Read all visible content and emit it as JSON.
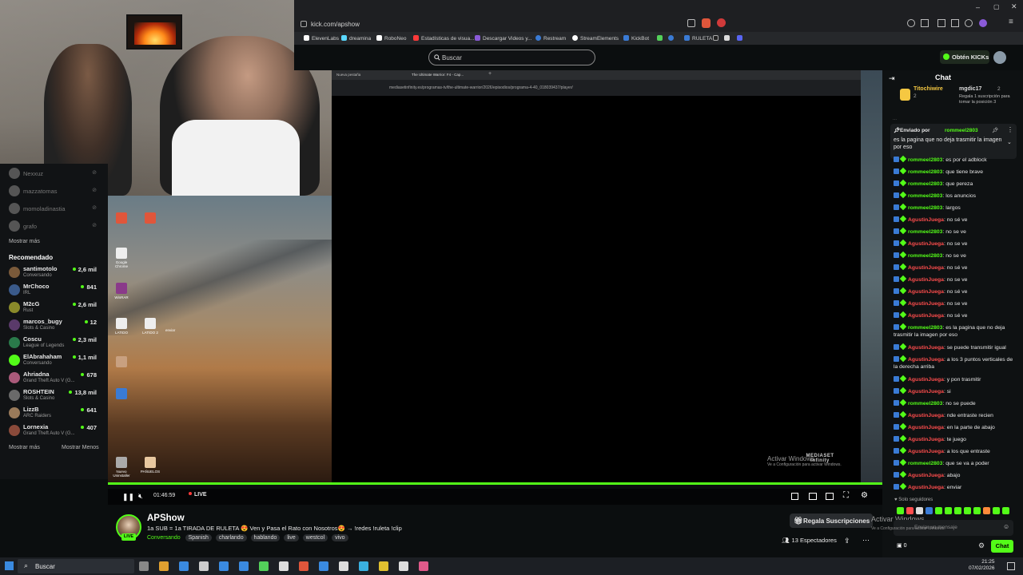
{
  "browser": {
    "url": "kick.com/apshow",
    "bookmarks": [
      "ElevenLabs",
      "dreamina",
      "RoboNeo",
      "Estadísticas de visua...",
      "Descargar Videos y...",
      "Restream",
      "StreamElements",
      "KickBot",
      "RULETA"
    ]
  },
  "header": {
    "search_placeholder": "Buscar",
    "kicks_button": "Obtén KICKs"
  },
  "sidebar": {
    "followed": [
      {
        "name": "Nexxuz"
      },
      {
        "name": "mazzatomas"
      },
      {
        "name": "momoladinastia"
      },
      {
        "name": "grafo"
      }
    ],
    "show_more": "Mostrar más",
    "recommended_title": "Recomendado",
    "recommended": [
      {
        "name": "santimotolo",
        "category": "Conversando",
        "viewers": "2,6 mil",
        "color": "#7a5a3a"
      },
      {
        "name": "MrChoco",
        "category": "IRL",
        "viewers": "841",
        "color": "#3a5a8a"
      },
      {
        "name": "M2cG",
        "category": "Rust",
        "viewers": "2,6 mil",
        "color": "#8a8a2a"
      },
      {
        "name": "marcos_bugy",
        "category": "Slots & Casino",
        "viewers": "12",
        "color": "#5a3a6a"
      },
      {
        "name": "Coscu",
        "category": "League of Legends",
        "viewers": "2,3 mil",
        "color": "#2a7a4a"
      },
      {
        "name": "ElAbrahaham",
        "category": "Conversando",
        "viewers": "1,1 mil",
        "color": "#53fc18"
      },
      {
        "name": "Ahriadna",
        "category": "Grand Theft Auto V (G...",
        "viewers": "678",
        "color": "#aa5a7a"
      },
      {
        "name": "ROSHTEIN",
        "category": "Slots & Casino",
        "viewers": "13,8 mil",
        "color": "#6a6a6a"
      },
      {
        "name": "LizzB",
        "category": "ARC Raiders",
        "viewers": "641",
        "color": "#9a7a5a"
      },
      {
        "name": "Lornexia",
        "category": "Grand Theft Auto V (G...",
        "viewers": "407",
        "color": "#8a4a3a"
      }
    ],
    "show_more_2": "Mostrar más",
    "show_less": "Mostrar Menos"
  },
  "desktop": {
    "icons": [
      "Google Chrome",
      "WinRAR",
      "LATIDO",
      "LATIDO 2",
      "enviar",
      "Nuevo Uninstaller",
      "PAÑUELOS"
    ]
  },
  "inner_browser": {
    "tab1": "Nueva pestaña",
    "tab2": "The Ultimate Warrior: F4 - Cap...",
    "url": "mediasetinfinity.es/programas-tv/the-ultimate-warrior/2026/episodios/programa-4-40_018039437/player/",
    "watermark_title": "Activar Windows",
    "watermark_sub": "Ve a Configuración para activar Windows.",
    "brand": "MEDIASET infinity"
  },
  "player": {
    "time": "01:46:59",
    "live_label": "LIVE",
    "progress": 1.0
  },
  "stream": {
    "streamer": "APShow",
    "title": "1a SUB = 1a TIRADA DE RULETA 😍 Ven y Pasa el Rato con Nosotros😍 → !redes !ruleta !clip",
    "category": "Conversando",
    "tags": [
      "Spanish",
      "charlando",
      "hablando",
      "live",
      "westcol",
      "vivo"
    ],
    "live_badge": "LIVE",
    "gift_button": "Regala Suscripciones",
    "viewers": "13 Espectadores"
  },
  "chat": {
    "title": "Chat",
    "top_gifters": [
      {
        "name": "Titochiwire",
        "count": "2"
      },
      {
        "name": "mgdic17",
        "count": "2"
      }
    ],
    "gift_note": "Regala 1 suscripción para tomar la posición 3",
    "pinned_by": "Enviado por",
    "pinned_user": "rommeel2803",
    "pinned_text": "es la pagina que no deja trasmitir la imagen por eso",
    "truncated_top": "...",
    "messages": [
      {
        "user": "rommeel2803",
        "text": ": es por el adblock",
        "c": "g"
      },
      {
        "user": "rommeel2803",
        "text": ": que tiene brave",
        "c": "g"
      },
      {
        "user": "rommeel2803",
        "text": ": que pereza",
        "c": "g"
      },
      {
        "user": "rommeel2803",
        "text": ": los anuncios",
        "c": "g"
      },
      {
        "user": "rommeel2803",
        "text": ": largos",
        "c": "g"
      },
      {
        "user": "AgustinJuega",
        "text": ": no sé ve",
        "c": "r"
      },
      {
        "user": "rommeel2803",
        "text": ": no se ve",
        "c": "g"
      },
      {
        "user": "AgustinJuega",
        "text": ": no se ve",
        "c": "r"
      },
      {
        "user": "rommeel2803",
        "text": ": no se ve",
        "c": "g"
      },
      {
        "user": "AgustinJuega",
        "text": ": no sé ve",
        "c": "r"
      },
      {
        "user": "AgustinJuega",
        "text": ": no se ve",
        "c": "r"
      },
      {
        "user": "AgustinJuega",
        "text": ": no sé ve",
        "c": "r"
      },
      {
        "user": "AgustinJuega",
        "text": ": no se ve",
        "c": "r"
      },
      {
        "user": "AgustinJuega",
        "text": ": no sé ve",
        "c": "r"
      },
      {
        "user": "rommeel2803",
        "text": ": es la pagina que no deja trasmitir la imagen por eso",
        "c": "g"
      },
      {
        "user": "AgustinJuega",
        "text": ": se puede transmitir igual",
        "c": "r"
      },
      {
        "user": "AgustinJuega",
        "text": ": a los 3 puntos verticales de la derecha arriba",
        "c": "r"
      },
      {
        "user": "AgustinJuega",
        "text": ": y pon trasmitir",
        "c": "r"
      },
      {
        "user": "AgustinJuega",
        "text": ": si",
        "c": "r"
      },
      {
        "user": "rommeel2803",
        "text": ": no se puede",
        "c": "g"
      },
      {
        "user": "AgustinJuega",
        "text": ": nde entraste recien",
        "c": "r"
      },
      {
        "user": "AgustinJuega",
        "text": ": en la parte de abajo",
        "c": "r"
      },
      {
        "user": "AgustinJuega",
        "text": ": te juego",
        "c": "r"
      },
      {
        "user": "AgustinJuega",
        "text": ": a los que entraste",
        "c": "r"
      },
      {
        "user": "rommeel2803",
        "text": ": que se va a poder",
        "c": "g"
      },
      {
        "user": "AgustinJuega",
        "text": ": abajo",
        "c": "r"
      },
      {
        "user": "AgustinJuega",
        "text": ": enviar",
        "c": "r"
      }
    ],
    "followers_only": "Solo seguidores",
    "input_placeholder": "Enviar un mensaje",
    "kicks_count": "0",
    "send_button": "Chat",
    "activate_title": "Activar Windows",
    "activate_sub": "Ve a Configuración para activar Windows."
  },
  "taskbar": {
    "search": "Buscar",
    "time": "21:25",
    "date": "07/02/2026"
  }
}
